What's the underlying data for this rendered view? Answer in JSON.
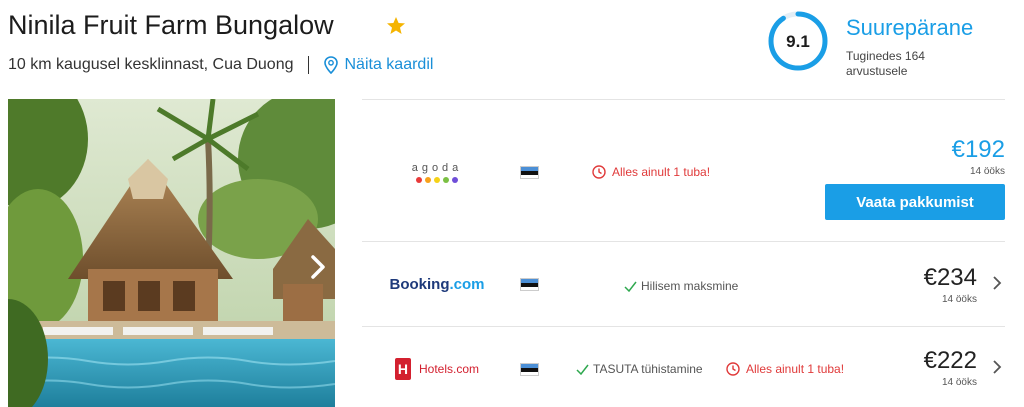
{
  "hotel": {
    "name": "Ninila Fruit Farm Bungalow",
    "location": "10 km kaugusel kesklinnast, Cua Duong",
    "map_link": "Näita kaardil"
  },
  "rating": {
    "score": "9.1",
    "label": "Suurepärane",
    "reviews": "Tuginedes 164 arvustusele"
  },
  "offers": [
    {
      "provider": "agoda",
      "avail": "Alles ainult 1 tuba!",
      "price": "€192",
      "nights": "14 ööks",
      "cta": "Vaata pakkumist"
    },
    {
      "provider": "Booking.com",
      "provider_main": "Booking",
      "provider_dot": ".com",
      "perk": "Hilisem maksmine",
      "price": "€234",
      "nights": "14 ööks"
    },
    {
      "provider": "Hotels.com",
      "perk": "TASUTA tühistamine",
      "avail": "Alles ainult 1 tuba!",
      "price": "€222",
      "nights": "14 ööks"
    }
  ],
  "colors": {
    "accent": "#1a9ee6",
    "warning": "#e03a3a",
    "perk_check": "#2fa84f",
    "star": "#f5b400"
  },
  "icons": {
    "star": "star-icon",
    "map_pin": "map-pin-icon",
    "clock": "clock-icon",
    "check": "check-icon",
    "next": "chevron-right-icon"
  }
}
